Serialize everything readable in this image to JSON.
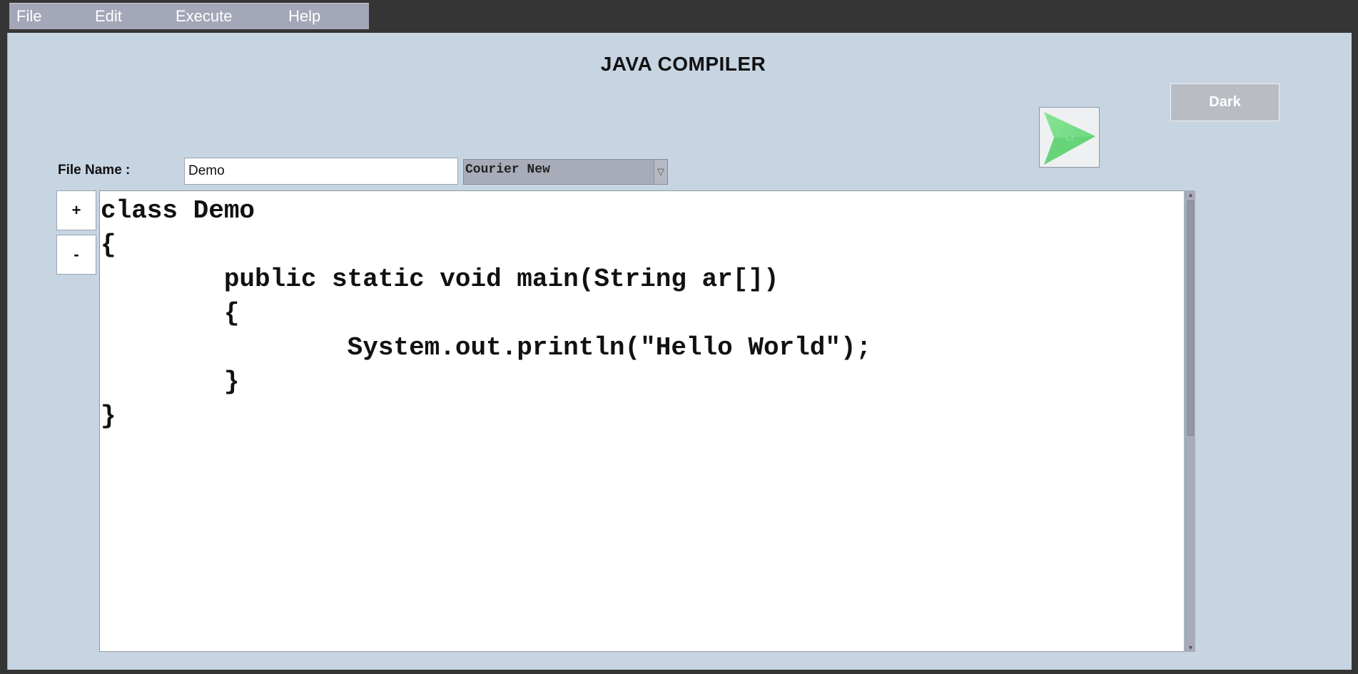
{
  "menubar": {
    "items": [
      {
        "label": "File"
      },
      {
        "label": "Edit"
      },
      {
        "label": "Execute"
      },
      {
        "label": "Help"
      }
    ]
  },
  "header": {
    "title": "JAVA COMPILER",
    "theme_button_label": "Dark",
    "run_button_icon": "run-play-icon"
  },
  "file_row": {
    "label": "File Name :",
    "filename_value": "Demo",
    "font_select_value": "Courier New"
  },
  "zoom": {
    "increase_label": "+",
    "decrease_label": "-"
  },
  "editor": {
    "code": "class Demo\n{\n\t\tpublic static void main(String ar[])\n\t\t{\n\t\t\t\tSystem.out.println(\"Hello World\");\n\t\t}\n}"
  },
  "colors": {
    "panel_background": "#c7d4e2",
    "menubar_background": "#a3a7b7",
    "run_icon_green": "#6fe07a"
  }
}
